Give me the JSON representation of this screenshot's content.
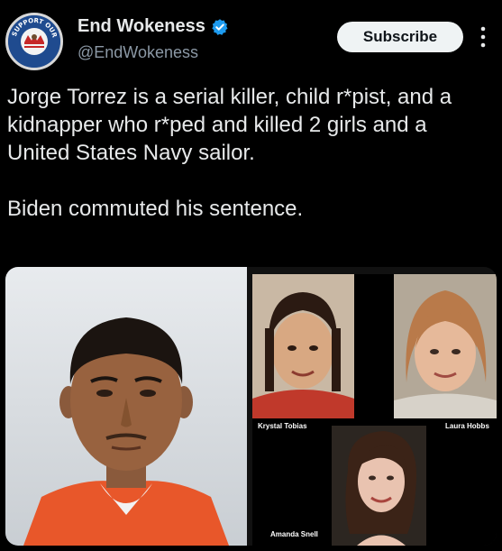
{
  "account": {
    "name": "End Wokeness",
    "handle": "@EndWokeness",
    "verified": true,
    "avatar_icon": "support-our-troops-badge-icon",
    "avatar_text": "SUPPORT OUR TROOPS"
  },
  "actions": {
    "subscribe_label": "Subscribe",
    "more_icon": "more-vertical-icon"
  },
  "tweet": {
    "paragraphs": [
      "Jorge Torrez is a serial killer, child r*pist, and a kidnapper who r*ped and killed 2 girls and a United States Navy sailor.",
      "Biden commuted his sentence."
    ]
  },
  "media": {
    "left_image": "mugshot-photo",
    "captions": {
      "victim_1": "Krystal Tobias",
      "victim_2": "Laura Hobbs",
      "victim_3": "Amanda Snell"
    }
  },
  "colors": {
    "background": "#000000",
    "text": "#e7e9ea",
    "secondary": "#8b98a5",
    "verified": "#1d9bf0",
    "button_bg": "#eff3f4"
  }
}
